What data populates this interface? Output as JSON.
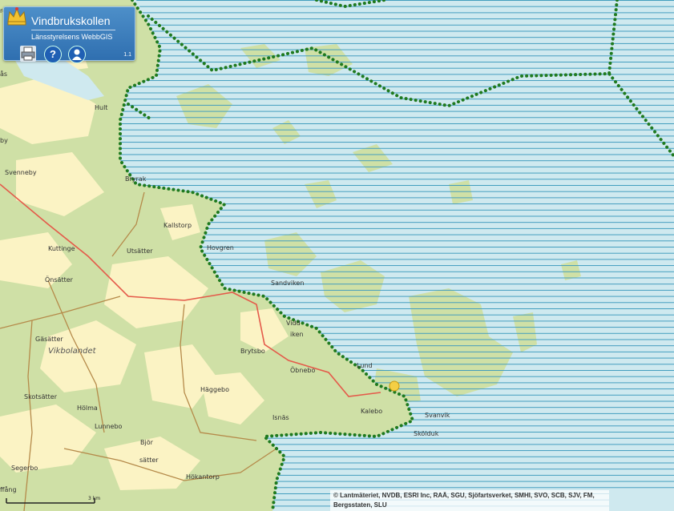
{
  "app": {
    "title": "Vindbrukskollen",
    "subtitle": "Länsstyrelsens WebbGIS",
    "version": "1.1"
  },
  "toolbar": {
    "print_icon": "printer-icon",
    "help_icon": "help-icon",
    "help_glyph": "?",
    "user_icon": "user-icon"
  },
  "map": {
    "places": [
      {
        "name": "Hult"
      },
      {
        "name": "Svenneby"
      },
      {
        "name": "Bryrak"
      },
      {
        "name": "Kallstorp"
      },
      {
        "name": "Hovgren"
      },
      {
        "name": "Kuttinge"
      },
      {
        "name": "Utsätter"
      },
      {
        "name": "Önsätter"
      },
      {
        "name": "Sandviken"
      },
      {
        "name": "Vidd"
      },
      {
        "name": "iken"
      },
      {
        "name": "Brytsbo"
      },
      {
        "name": "Öbnebo"
      },
      {
        "name": "Gäsätter"
      },
      {
        "name": "Vikbolandet"
      },
      {
        "name": "Häggebo"
      },
      {
        "name": "Skotsätter"
      },
      {
        "name": "Hölma"
      },
      {
        "name": "Lunnebo"
      },
      {
        "name": "Isnäs"
      },
      {
        "name": "Kalebo"
      },
      {
        "name": "Svanvik"
      },
      {
        "name": "Skölduk"
      },
      {
        "name": "Björ"
      },
      {
        "name": "sätter"
      },
      {
        "name": "Hökantorp"
      },
      {
        "name": "Segerbo"
      },
      {
        "name": "rg"
      },
      {
        "name": "ås"
      },
      {
        "name": "by"
      },
      {
        "name": "Lund"
      },
      {
        "name": "ffång"
      }
    ],
    "scale_label": "3 km",
    "attribution": "© Lantmäteriet, NVDB, ESRI Inc, RAÄ, SGU, Sjöfartsverket, SMHI, SVO, SCB, SJV, FM, Bergsstaten, SLU"
  },
  "colors": {
    "land": "#cfe0a6",
    "forest": "#b8d389",
    "field": "#fbf3c4",
    "water": "#cfe9ef",
    "hatch": "#3f9bbd",
    "boundary": "#1f7a1f",
    "road_main": "#e45a4a",
    "road_minor": "#b58a4a"
  }
}
